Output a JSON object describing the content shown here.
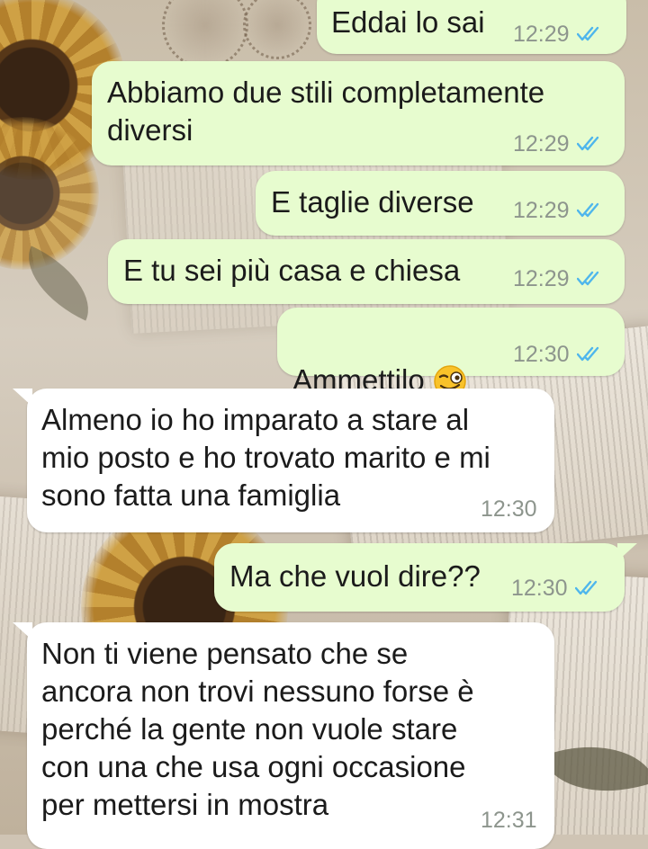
{
  "messages": [
    {
      "direction": "outgoing",
      "text": "Eddai lo sai",
      "time": "12:29",
      "status": "read"
    },
    {
      "direction": "outgoing",
      "text": "Abbiamo due stili completamente\ndiversi",
      "time": "12:29",
      "status": "read"
    },
    {
      "direction": "outgoing",
      "text": "E taglie diverse",
      "time": "12:29",
      "status": "read"
    },
    {
      "direction": "outgoing",
      "text": "E tu sei più casa e chiesa",
      "time": "12:29",
      "status": "read"
    },
    {
      "direction": "outgoing",
      "text": "Ammettilo",
      "emoji": "winking-face-with-tongue",
      "time": "12:30",
      "status": "read"
    },
    {
      "direction": "incoming",
      "text": "Almeno io ho imparato a stare al\nmio posto e ho trovato marito e mi\nsono fatta una famiglia",
      "time": "12:30"
    },
    {
      "direction": "outgoing",
      "text": "Ma che vuol dire??",
      "time": "12:30",
      "status": "read"
    },
    {
      "direction": "incoming",
      "text": "Non ti viene pensato che se\nancora non trovi nessuno forse è\nperché la gente non vuole stare\ncon una che usa ogni occasione\nper mettersi in mostra",
      "time": "12:31"
    }
  ],
  "colors": {
    "outgoing_bubble": "#e7fccf",
    "incoming_bubble": "#ffffff",
    "read_ticks": "#4fb6ec",
    "timestamp": "#8d958d"
  }
}
